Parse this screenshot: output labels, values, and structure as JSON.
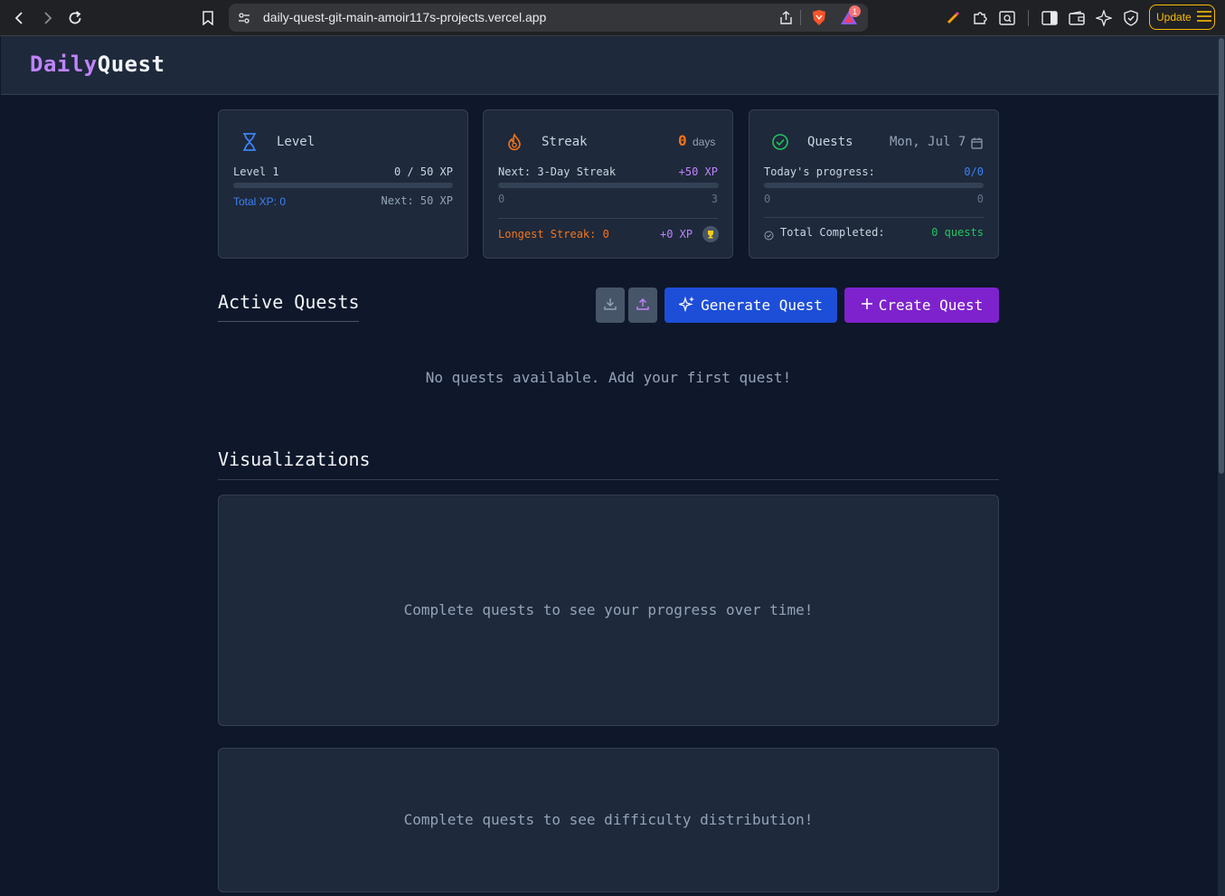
{
  "browser": {
    "url": "daily-quest-git-main-amoir117s-projects.vercel.app",
    "update_label": "Update",
    "notification_count": "1"
  },
  "app": {
    "logo_part1": "Daily",
    "logo_part2": "Quest"
  },
  "level_card": {
    "title": "Level",
    "level_label": "Level 1",
    "xp_progress": "0 / 50 XP",
    "progress_fraction": 0,
    "total_xp": "Total XP: 0",
    "next_xp": "Next: 50 XP"
  },
  "streak_card": {
    "title": "Streak",
    "days_count": "0",
    "days_label": "days",
    "next_label": "Next: 3-Day Streak",
    "next_bonus": "+50 XP",
    "progress_fraction": 0,
    "min": "0",
    "max": "3",
    "longest_label": "Longest Streak: 0",
    "longest_xp": "+0 XP"
  },
  "quests_card": {
    "title": "Quests",
    "date": "Mon, Jul 7",
    "progress_label": "Today's progress:",
    "progress_value": "0/0",
    "progress_fraction": 0,
    "min": "0",
    "max": "0",
    "total_label": "Total Completed:",
    "total_value": "0 quests"
  },
  "active_quests": {
    "title": "Active Quests",
    "generate_label": "Generate Quest",
    "create_label": "Create Quest",
    "empty_text": "No quests available. Add your first quest!"
  },
  "visualizations": {
    "title": "Visualizations",
    "progress_empty": "Complete quests to see your progress over time!",
    "difficulty_empty": "Complete quests to see difficulty distribution!"
  },
  "colors": {
    "accent_purple": "#c084fc",
    "accent_blue": "#3b82f6",
    "streak_orange": "#f97316",
    "success_green": "#22c55e",
    "generate_btn": "#1d4ed8",
    "create_btn": "#7e22ce"
  }
}
